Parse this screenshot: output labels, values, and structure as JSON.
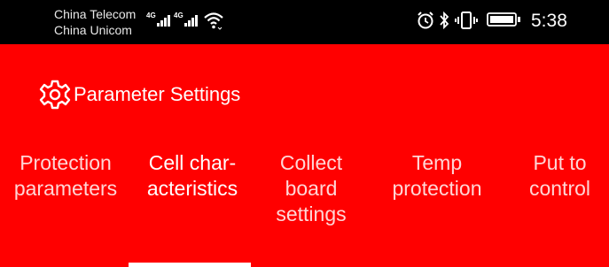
{
  "status_bar": {
    "carrier_1": "China Telecom",
    "carrier_2": "China Unicom",
    "network_1": "4G",
    "network_2": "4G",
    "time": "5:38",
    "icons": [
      "signal-icon",
      "wifi-icon",
      "alarm-icon",
      "bluetooth-icon",
      "vibrate-icon",
      "battery-icon"
    ]
  },
  "header": {
    "title": "Parameter Settings",
    "icon": "gear-icon"
  },
  "tabs": [
    {
      "line1": "Protection",
      "line2": "parameters",
      "line3": "",
      "active": false
    },
    {
      "line1": "Cell char-",
      "line2": "acteristics",
      "line3": "",
      "active": true
    },
    {
      "line1": "Collect",
      "line2": "board",
      "line3": "settings",
      "active": false
    },
    {
      "line1": "Temp",
      "line2": "protection",
      "line3": "",
      "active": false
    },
    {
      "line1": "Put to",
      "line2": "control",
      "line3": "",
      "active": false
    }
  ],
  "colors": {
    "background": "#ff0000",
    "status_bar": "#000000",
    "active_tab": "#ffffff",
    "inactive_tab": "#ffd6d6"
  }
}
